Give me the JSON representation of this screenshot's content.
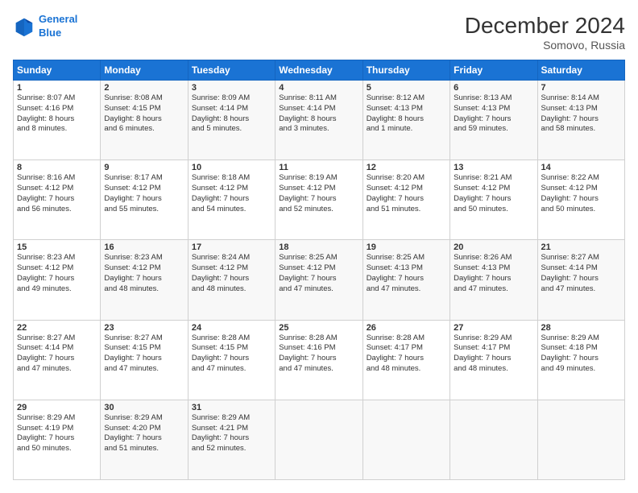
{
  "header": {
    "logo_line1": "General",
    "logo_line2": "Blue",
    "month": "December 2024",
    "location": "Somovo, Russia"
  },
  "days_of_week": [
    "Sunday",
    "Monday",
    "Tuesday",
    "Wednesday",
    "Thursday",
    "Friday",
    "Saturday"
  ],
  "weeks": [
    [
      {
        "day": 1,
        "lines": [
          "Sunrise: 8:07 AM",
          "Sunset: 4:16 PM",
          "Daylight: 8 hours",
          "and 8 minutes."
        ]
      },
      {
        "day": 2,
        "lines": [
          "Sunrise: 8:08 AM",
          "Sunset: 4:15 PM",
          "Daylight: 8 hours",
          "and 6 minutes."
        ]
      },
      {
        "day": 3,
        "lines": [
          "Sunrise: 8:09 AM",
          "Sunset: 4:14 PM",
          "Daylight: 8 hours",
          "and 5 minutes."
        ]
      },
      {
        "day": 4,
        "lines": [
          "Sunrise: 8:11 AM",
          "Sunset: 4:14 PM",
          "Daylight: 8 hours",
          "and 3 minutes."
        ]
      },
      {
        "day": 5,
        "lines": [
          "Sunrise: 8:12 AM",
          "Sunset: 4:13 PM",
          "Daylight: 8 hours",
          "and 1 minute."
        ]
      },
      {
        "day": 6,
        "lines": [
          "Sunrise: 8:13 AM",
          "Sunset: 4:13 PM",
          "Daylight: 7 hours",
          "and 59 minutes."
        ]
      },
      {
        "day": 7,
        "lines": [
          "Sunrise: 8:14 AM",
          "Sunset: 4:13 PM",
          "Daylight: 7 hours",
          "and 58 minutes."
        ]
      }
    ],
    [
      {
        "day": 8,
        "lines": [
          "Sunrise: 8:16 AM",
          "Sunset: 4:12 PM",
          "Daylight: 7 hours",
          "and 56 minutes."
        ]
      },
      {
        "day": 9,
        "lines": [
          "Sunrise: 8:17 AM",
          "Sunset: 4:12 PM",
          "Daylight: 7 hours",
          "and 55 minutes."
        ]
      },
      {
        "day": 10,
        "lines": [
          "Sunrise: 8:18 AM",
          "Sunset: 4:12 PM",
          "Daylight: 7 hours",
          "and 54 minutes."
        ]
      },
      {
        "day": 11,
        "lines": [
          "Sunrise: 8:19 AM",
          "Sunset: 4:12 PM",
          "Daylight: 7 hours",
          "and 52 minutes."
        ]
      },
      {
        "day": 12,
        "lines": [
          "Sunrise: 8:20 AM",
          "Sunset: 4:12 PM",
          "Daylight: 7 hours",
          "and 51 minutes."
        ]
      },
      {
        "day": 13,
        "lines": [
          "Sunrise: 8:21 AM",
          "Sunset: 4:12 PM",
          "Daylight: 7 hours",
          "and 50 minutes."
        ]
      },
      {
        "day": 14,
        "lines": [
          "Sunrise: 8:22 AM",
          "Sunset: 4:12 PM",
          "Daylight: 7 hours",
          "and 50 minutes."
        ]
      }
    ],
    [
      {
        "day": 15,
        "lines": [
          "Sunrise: 8:23 AM",
          "Sunset: 4:12 PM",
          "Daylight: 7 hours",
          "and 49 minutes."
        ]
      },
      {
        "day": 16,
        "lines": [
          "Sunrise: 8:23 AM",
          "Sunset: 4:12 PM",
          "Daylight: 7 hours",
          "and 48 minutes."
        ]
      },
      {
        "day": 17,
        "lines": [
          "Sunrise: 8:24 AM",
          "Sunset: 4:12 PM",
          "Daylight: 7 hours",
          "and 48 minutes."
        ]
      },
      {
        "day": 18,
        "lines": [
          "Sunrise: 8:25 AM",
          "Sunset: 4:12 PM",
          "Daylight: 7 hours",
          "and 47 minutes."
        ]
      },
      {
        "day": 19,
        "lines": [
          "Sunrise: 8:25 AM",
          "Sunset: 4:13 PM",
          "Daylight: 7 hours",
          "and 47 minutes."
        ]
      },
      {
        "day": 20,
        "lines": [
          "Sunrise: 8:26 AM",
          "Sunset: 4:13 PM",
          "Daylight: 7 hours",
          "and 47 minutes."
        ]
      },
      {
        "day": 21,
        "lines": [
          "Sunrise: 8:27 AM",
          "Sunset: 4:14 PM",
          "Daylight: 7 hours",
          "and 47 minutes."
        ]
      }
    ],
    [
      {
        "day": 22,
        "lines": [
          "Sunrise: 8:27 AM",
          "Sunset: 4:14 PM",
          "Daylight: 7 hours",
          "and 47 minutes."
        ]
      },
      {
        "day": 23,
        "lines": [
          "Sunrise: 8:27 AM",
          "Sunset: 4:15 PM",
          "Daylight: 7 hours",
          "and 47 minutes."
        ]
      },
      {
        "day": 24,
        "lines": [
          "Sunrise: 8:28 AM",
          "Sunset: 4:15 PM",
          "Daylight: 7 hours",
          "and 47 minutes."
        ]
      },
      {
        "day": 25,
        "lines": [
          "Sunrise: 8:28 AM",
          "Sunset: 4:16 PM",
          "Daylight: 7 hours",
          "and 47 minutes."
        ]
      },
      {
        "day": 26,
        "lines": [
          "Sunrise: 8:28 AM",
          "Sunset: 4:17 PM",
          "Daylight: 7 hours",
          "and 48 minutes."
        ]
      },
      {
        "day": 27,
        "lines": [
          "Sunrise: 8:29 AM",
          "Sunset: 4:17 PM",
          "Daylight: 7 hours",
          "and 48 minutes."
        ]
      },
      {
        "day": 28,
        "lines": [
          "Sunrise: 8:29 AM",
          "Sunset: 4:18 PM",
          "Daylight: 7 hours",
          "and 49 minutes."
        ]
      }
    ],
    [
      {
        "day": 29,
        "lines": [
          "Sunrise: 8:29 AM",
          "Sunset: 4:19 PM",
          "Daylight: 7 hours",
          "and 50 minutes."
        ]
      },
      {
        "day": 30,
        "lines": [
          "Sunrise: 8:29 AM",
          "Sunset: 4:20 PM",
          "Daylight: 7 hours",
          "and 51 minutes."
        ]
      },
      {
        "day": 31,
        "lines": [
          "Sunrise: 8:29 AM",
          "Sunset: 4:21 PM",
          "Daylight: 7 hours",
          "and 52 minutes."
        ]
      },
      null,
      null,
      null,
      null
    ]
  ]
}
